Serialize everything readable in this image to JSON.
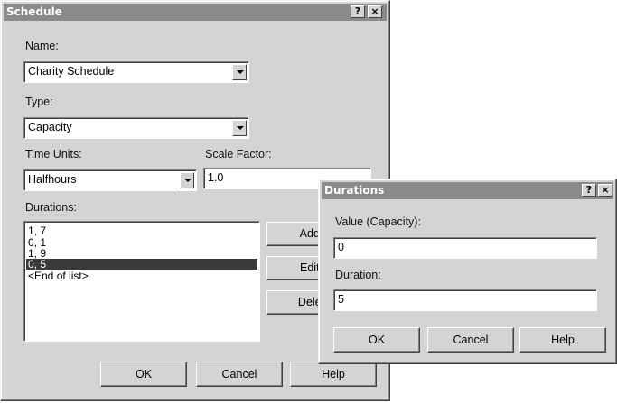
{
  "schedule": {
    "title": "Schedule",
    "help_btn": "?",
    "close_btn": "×",
    "name_label": "Name:",
    "name_value": "Charity Schedule",
    "type_label": "Type:",
    "type_value": "Capacity",
    "time_units_label": "Time Units:",
    "time_units_value": "Halfhours",
    "scale_factor_label": "Scale Factor:",
    "scale_factor_value": "1.0",
    "durations_label": "Durations:",
    "durations_list": [
      "1, 7",
      "0, 1",
      "1, 9",
      "0, 5",
      "<End of list>"
    ],
    "selected_index": 3,
    "add_btn": "Add...",
    "edit_btn": "Edit...",
    "delete_btn": "Delete",
    "ok_btn": "OK",
    "cancel_btn": "Cancel",
    "help_label": "Help",
    "icons": {
      "dropdown": "chevron-down-icon",
      "help": "question-icon",
      "close": "close-icon"
    }
  },
  "durations_dialog": {
    "title": "Durations",
    "help_btn": "?",
    "close_btn": "×",
    "value_label": "Value (Capacity):",
    "value_value": "0",
    "duration_label": "Duration:",
    "duration_value": "5",
    "ok_btn": "OK",
    "cancel_btn": "Cancel",
    "help_label": "Help"
  }
}
